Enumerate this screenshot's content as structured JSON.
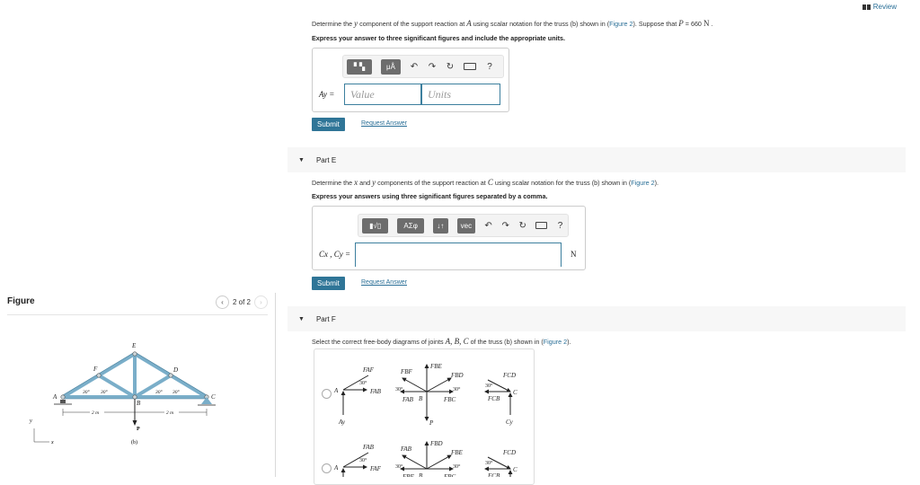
{
  "header": {
    "review_label": "Review"
  },
  "figure": {
    "title": "Figure",
    "pager": "2 of 2",
    "prev_icon": "chevron-left-icon",
    "next_icon": "chevron-right-icon",
    "truss": {
      "joints": [
        "A",
        "B",
        "C",
        "D",
        "E",
        "F"
      ],
      "angles": [
        "30°",
        "30°",
        "30°",
        "30°"
      ],
      "spans": [
        "2 m",
        "2 m"
      ],
      "load_label": "P",
      "caption": "(b)",
      "axes": {
        "x": "x",
        "y": "y"
      }
    }
  },
  "part_d": {
    "question_prefix": "Determine the ",
    "question_var": "y",
    "question_mid": " component of the support reaction at ",
    "question_point": "A",
    "question_mid2": " using scalar notation for the truss (b) shown in (",
    "figure_link": "Figure 2",
    "question_suffix": "). Suppose that ",
    "param_var": "P",
    "param_value": " = 660 ",
    "param_unit": "N",
    "question_end": " .",
    "instruction": "Express your answer to three significant figures and include the appropriate units.",
    "toolbar": {
      "btn1": "▘▚",
      "btn2": "μÅ",
      "undo": "↶",
      "redo": "↷",
      "reset": "↻",
      "help": "?"
    },
    "answer_label": "Ay =",
    "value_placeholder": "Value",
    "units_placeholder": "Units",
    "submit_label": "Submit",
    "request_label": "Request Answer"
  },
  "part_e": {
    "title": "Part E",
    "question_prefix": "Determine the ",
    "var_x": "x",
    "q_and": " and ",
    "var_y": "y",
    "question_mid": " components of the support reaction at ",
    "question_point": "C",
    "question_mid2": " using scalar notation for the truss (b) shown in (",
    "figure_link": "Figure 2",
    "question_suffix": ").",
    "instruction": "Express your answers using three significant figures separated by a comma.",
    "toolbar": {
      "btn1": "▮√▯",
      "btn2": "ΑΣφ",
      "btn3": "↓↑",
      "btn4": "vec",
      "undo": "↶",
      "redo": "↷",
      "reset": "↻",
      "help": "?"
    },
    "answer_label": "Cx , Cy =",
    "answer_value": "",
    "unit": "N",
    "submit_label": "Submit",
    "request_label": "Request Answer"
  },
  "part_f": {
    "title": "Part F",
    "question_prefix": "Select the correct free-body diagrams of joints ",
    "joints": "A, B, C",
    "question_mid": " of the truss (b) shown in (",
    "figure_link": "Figure 2",
    "question_suffix": ").",
    "options": [
      {
        "A": {
          "labels": [
            "FAF",
            "30°",
            "FAB",
            "A",
            "Ay"
          ]
        },
        "B": {
          "labels": [
            "FBF",
            "FBE",
            "FBD",
            "30°",
            "30°",
            "FAB",
            "B",
            "FBC",
            "P"
          ]
        },
        "C": {
          "labels": [
            "FCD",
            "30°",
            "FCB",
            "C",
            "Cy"
          ]
        }
      },
      {
        "A": {
          "labels": [
            "FAB",
            "30°",
            "FAF",
            "A"
          ]
        },
        "B": {
          "labels": [
            "FAB",
            "FBD",
            "FBE",
            "30°",
            "30°",
            "FBF",
            "B",
            "FBC"
          ]
        },
        "C": {
          "labels": [
            "FCD",
            "30°",
            "FCB",
            "C"
          ]
        }
      }
    ]
  }
}
